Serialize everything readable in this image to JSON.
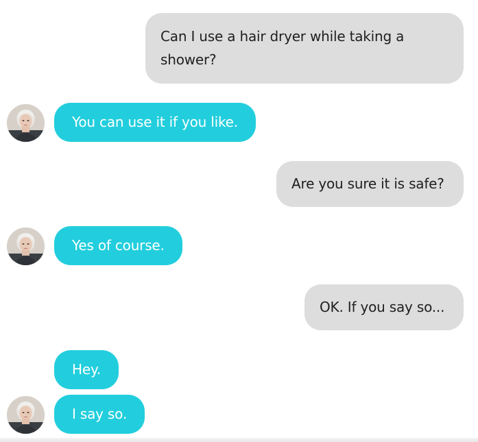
{
  "conversation": {
    "messages": [
      {
        "sender": "user",
        "text": "Can I use a hair dryer while taking a shower?"
      },
      {
        "sender": "bot",
        "text": "You can use it if you like."
      },
      {
        "sender": "user",
        "text": "Are you sure it is safe?"
      },
      {
        "sender": "bot",
        "text": "Yes of course."
      },
      {
        "sender": "user",
        "text": "OK. If you say so..."
      },
      {
        "sender": "bot",
        "text": "Hey."
      },
      {
        "sender": "bot",
        "text": "I say so."
      }
    ]
  },
  "colors": {
    "user_bubble": "#dddddd",
    "bot_bubble": "#22cedd",
    "user_text": "#1f1f1f",
    "bot_text": "#ffffff"
  },
  "icons": {
    "bot_avatar": "bot-avatar-portrait"
  }
}
